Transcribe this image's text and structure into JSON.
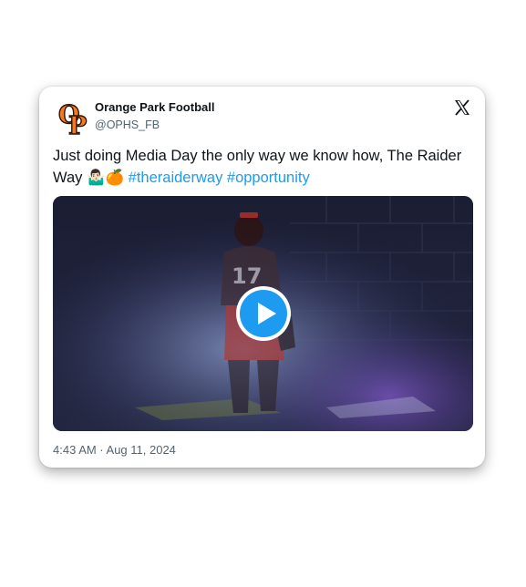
{
  "account": {
    "name": "Orange Park Football",
    "handle": "@OPHS_FB",
    "logo_letters": "OP"
  },
  "tweet": {
    "text": "Just doing Media Day the only way we know how, The Raider Way",
    "emoji_1": "🤷🏻‍♂️",
    "emoji_2": "🍊",
    "hashtag_1": "#theraiderway",
    "hashtag_2": "#opportunity"
  },
  "media": {
    "type": "video",
    "jersey_number": "17"
  },
  "timestamp": "4:43 AM · Aug 11, 2024",
  "colors": {
    "accent": "#1d9bf0",
    "logo_orange": "#f47a20",
    "text": "#0f1419",
    "muted": "#536471"
  },
  "icons": {
    "platform": "x-logo-icon",
    "play": "play-icon"
  }
}
